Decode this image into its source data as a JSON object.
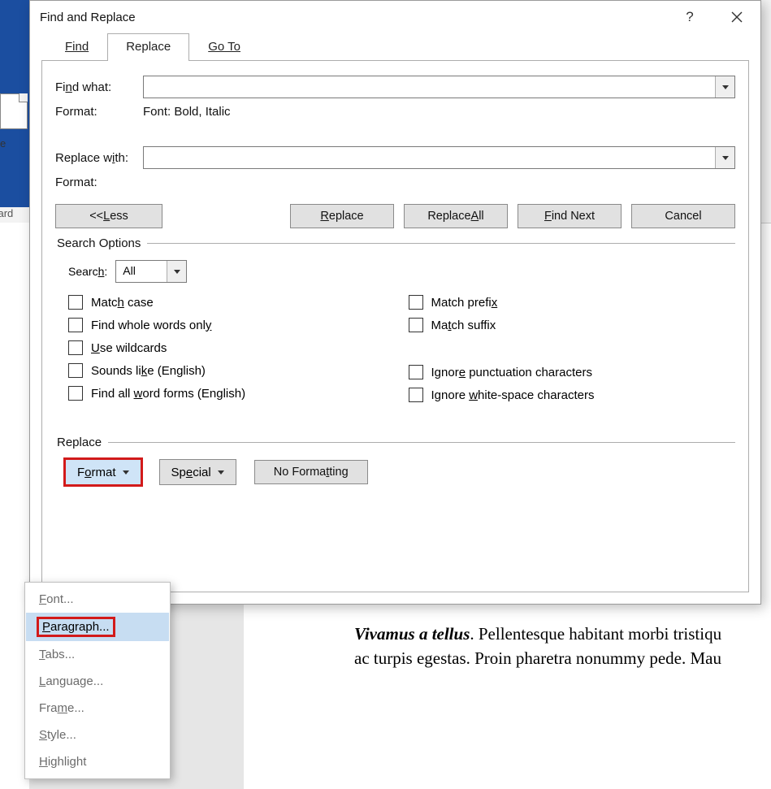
{
  "background": {
    "clipboard_label": "board",
    "doc_letter": "e",
    "doc_line1_prefix_bold": "Vivamus a tellus",
    "doc_line1_rest": ". Pellentesque habitant morbi tristiqu",
    "doc_line2": "ac turpis egestas. Proin pharetra nonummy pede. Mau"
  },
  "dialog": {
    "title": "Find and Replace",
    "help": "?",
    "close": "✕",
    "tabs": {
      "find": "Find",
      "replace": "Replace",
      "goto": "Go To"
    },
    "find_what_label": "Find what:",
    "format_label": "Format:",
    "find_format_value": "Font: Bold, Italic",
    "replace_with_label": "Replace with:",
    "replace_format_value": "",
    "buttons": {
      "less": "<< Less",
      "replace": "Replace",
      "replace_all": "Replace All",
      "find_next": "Find Next",
      "cancel": "Cancel"
    },
    "search_options_legend": "Search Options",
    "search_label": "Search:",
    "search_value": "All",
    "checks": {
      "match_case": "Match case",
      "whole_words": "Find whole words only",
      "wildcards": "Use wildcards",
      "sounds_like": "Sounds like (English)",
      "word_forms": "Find all word forms (English)",
      "match_prefix": "Match prefix",
      "match_suffix": "Match suffix",
      "ignore_punct": "Ignore punctuation characters",
      "ignore_ws": "Ignore white-space characters"
    },
    "replace_legend": "Replace",
    "bottom": {
      "format": "Format",
      "special": "Special",
      "no_formatting": "No Formatting"
    }
  },
  "menu": {
    "font": "Font...",
    "paragraph": "Paragraph...",
    "tabs": "Tabs...",
    "language": "Language...",
    "frame": "Frame...",
    "style": "Style...",
    "highlight": "Highlight"
  }
}
